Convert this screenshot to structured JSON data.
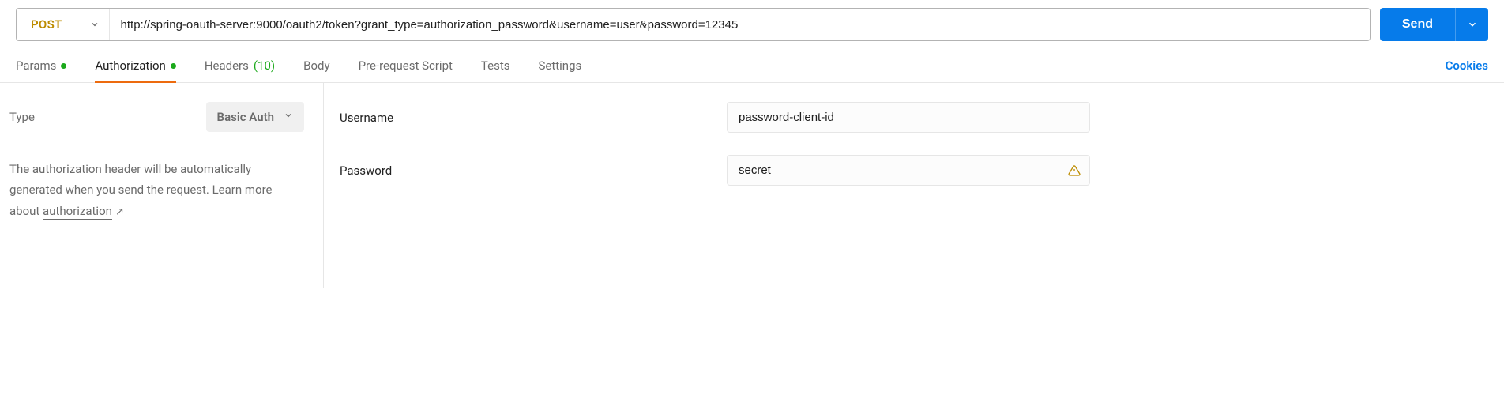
{
  "request": {
    "method": "POST",
    "url": "http://spring-oauth-server:9000/oauth2/token?grant_type=authorization_password&username=user&password=12345",
    "send_label": "Send"
  },
  "tabs": {
    "items": [
      {
        "label": "Params",
        "has_dot": true
      },
      {
        "label": "Authorization",
        "has_dot": true
      },
      {
        "label": "Headers",
        "count": "(10)"
      },
      {
        "label": "Body"
      },
      {
        "label": "Pre-request Script"
      },
      {
        "label": "Tests"
      },
      {
        "label": "Settings"
      }
    ],
    "cookies_label": "Cookies"
  },
  "auth": {
    "type_label": "Type",
    "type_value": "Basic Auth",
    "description_prefix": "The authorization header will be automatically generated when you send the request. Learn more about ",
    "link_text": "authorization",
    "fields": {
      "username_label": "Username",
      "username_value": "password-client-id",
      "password_label": "Password",
      "password_value": "secret"
    }
  },
  "colors": {
    "accent": "#067bea",
    "method": "#bd8c00",
    "tab_active": "#ed6b0e",
    "green": "#1ba91b"
  }
}
